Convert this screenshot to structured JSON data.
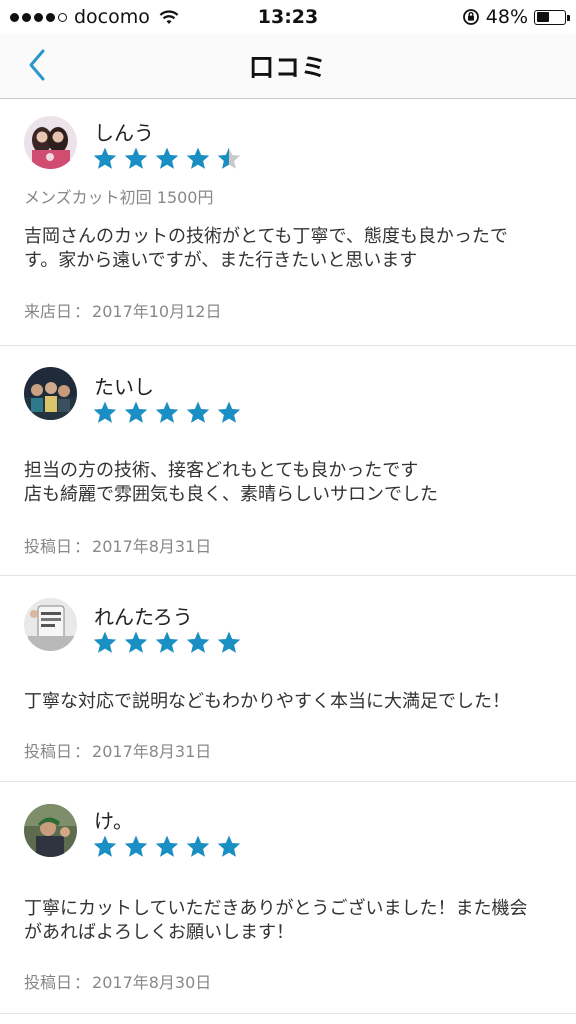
{
  "status_bar": {
    "carrier": "docomo",
    "time": "13:23",
    "battery_percent": "48%",
    "battery_level": 0.48,
    "signal_filled_dots": 4,
    "signal_total_dots": 5
  },
  "nav": {
    "title": "口コミ",
    "back_icon": "chevron-left-icon"
  },
  "colors": {
    "accent": "#2a96cc",
    "star": "#1a8fc4",
    "star_empty": "#c9c9c9",
    "muted_text": "#888888"
  },
  "reviews": [
    {
      "user": "しんう",
      "rating": 4.5,
      "service": "メンズカット初回 1500円",
      "text": [
        "吉岡さんのカットの技術がとても丁寧で、態度も良かったで",
        "す。家から遠いですが、また行きたいと思います"
      ],
      "date_label": "来店日",
      "date": "2017年10月12日"
    },
    {
      "user": "たいし",
      "rating": 5,
      "service": "",
      "text": [
        "担当の方の技術、接客どれもとても良かったです",
        "店も綺麗で雰囲気も良く、素晴らしいサロンでした"
      ],
      "date_label": "投稿日",
      "date": "2017年8月31日"
    },
    {
      "user": "れんたろう",
      "rating": 5,
      "service": "",
      "text": [
        "丁寧な対応で説明などもわかりやすく本当に大満足でした！"
      ],
      "date_label": "投稿日",
      "date": "2017年8月31日"
    },
    {
      "user": "け。",
      "rating": 5,
      "service": "",
      "text": [
        "丁寧にカットしていただきありがとうございました！また機会",
        "があればよろしくお願いします！"
      ],
      "date_label": "投稿日",
      "date": "2017年8月30日"
    }
  ]
}
